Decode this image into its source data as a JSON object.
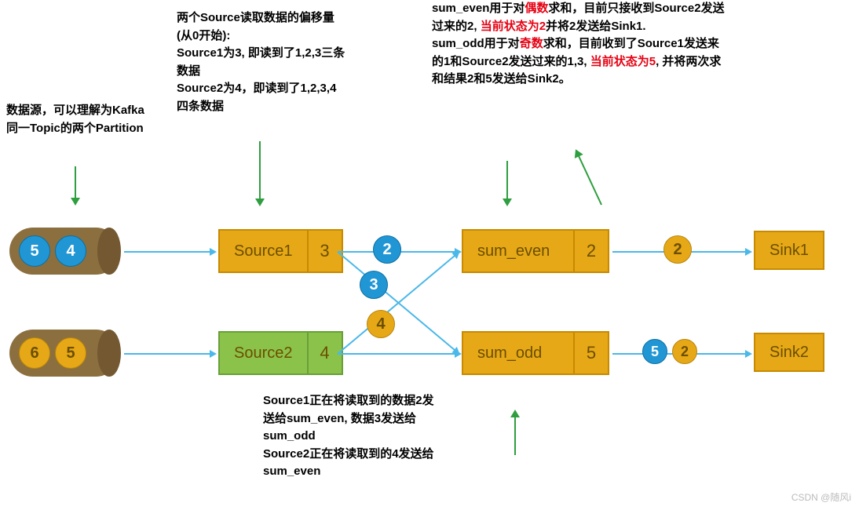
{
  "annotations": {
    "topLeft": "数据源，可以理解为Kafka同一Topic的两个Partition",
    "topMid": "两个Source读取数据的偏移量(从0开始):\nSource1为3, 即读到了1,2,3三条数据\nSource2为4，即读到了1,2,3,4四条数据",
    "topRight_line1": "sum_even用于对",
    "topRight_even": "偶数",
    "topRight_line1b": "求和，目前只接收到Source2发送过来的2,",
    "topRight_state1a": "当前状态为2",
    "topRight_state1b": "并将2发送给Sink1.",
    "topRight_line2a": "sum_odd用于对",
    "topRight_odd": "奇数",
    "topRight_line2b": "求和，目前收到了Source1发送来的1和Source2发送过来的1,3, ",
    "topRight_state2": "当前状态为5",
    "topRight_line2c": ", 并将两次求和结果2和5发送给Sink2。",
    "bottom": "Source1正在将读取到的数据2发送给sum_even, 数据3发送给sum_odd\nSource2正在将读取到的4发送给sum_even"
  },
  "partitions": {
    "p1": [
      "5",
      "4"
    ],
    "p2": [
      "6",
      "5"
    ]
  },
  "sources": {
    "s1": {
      "label": "Source1",
      "offset": "3"
    },
    "s2": {
      "label": "Source2",
      "offset": "4"
    }
  },
  "midValues": {
    "v2": "2",
    "v3": "3",
    "v4": "4"
  },
  "ops": {
    "even": {
      "label": "sum_even",
      "state": "2"
    },
    "odd": {
      "label": "sum_odd",
      "state": "5"
    }
  },
  "outflow": {
    "even": "2",
    "odd_a": "5",
    "odd_b": "2"
  },
  "sinks": {
    "s1": "Sink1",
    "s2": "Sink2"
  },
  "watermark": "CSDN @随风i"
}
